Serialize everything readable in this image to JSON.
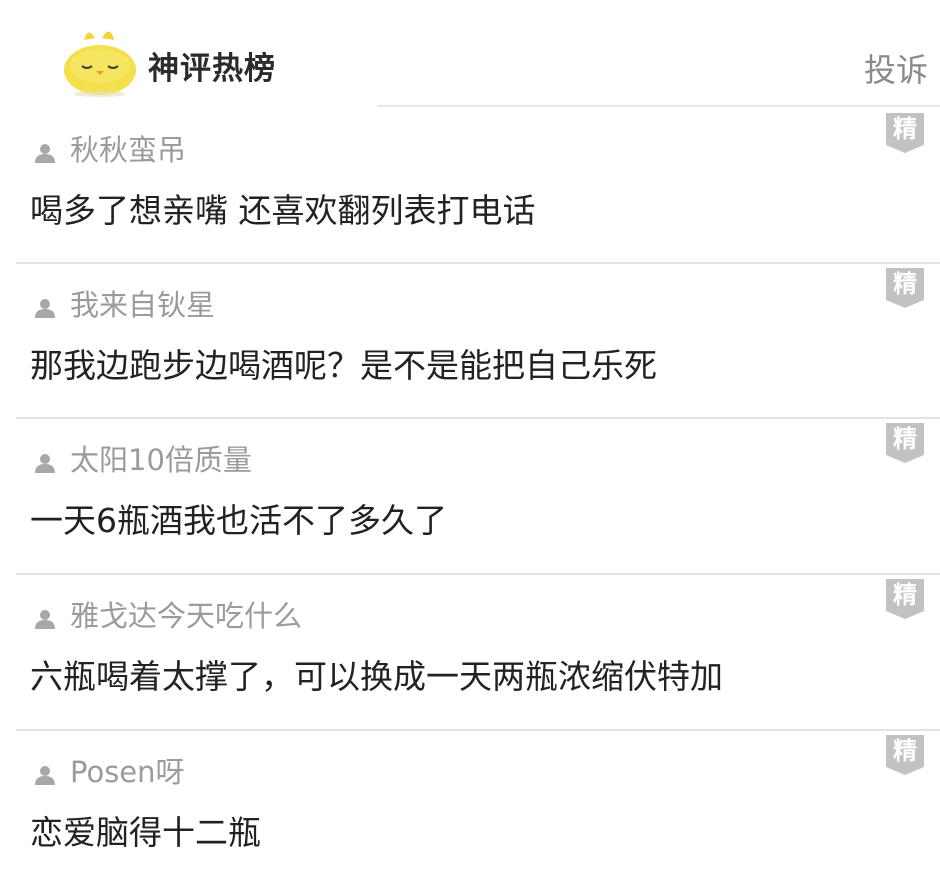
{
  "header": {
    "brand_title": "神评热榜",
    "report_label": "投诉",
    "mascot_icon": "yellow-chick-mascot-icon"
  },
  "featured_badge_label": "精",
  "colors": {
    "badge_gray": "#c2c2c2",
    "mascot_yellow": "#f4e04d",
    "username_gray": "#9b9b9b",
    "text_dark": "#222222"
  },
  "comments": [
    {
      "username": "秋秋蛮吊",
      "text": "喝多了想亲嘴 还喜欢翻列表打电话"
    },
    {
      "username": "我来自钬星",
      "text": "那我边跑步边喝酒呢？是不是能把自己乐死"
    },
    {
      "username": "太阳10倍质量",
      "text": "一天6瓶酒我也活不了多久了"
    },
    {
      "username": "雅戈达今天吃什么",
      "text": "六瓶喝着太撑了，可以换成一天两瓶浓缩伏特加"
    },
    {
      "username": "Posen呀",
      "text": "恋爱脑得十二瓶"
    }
  ]
}
